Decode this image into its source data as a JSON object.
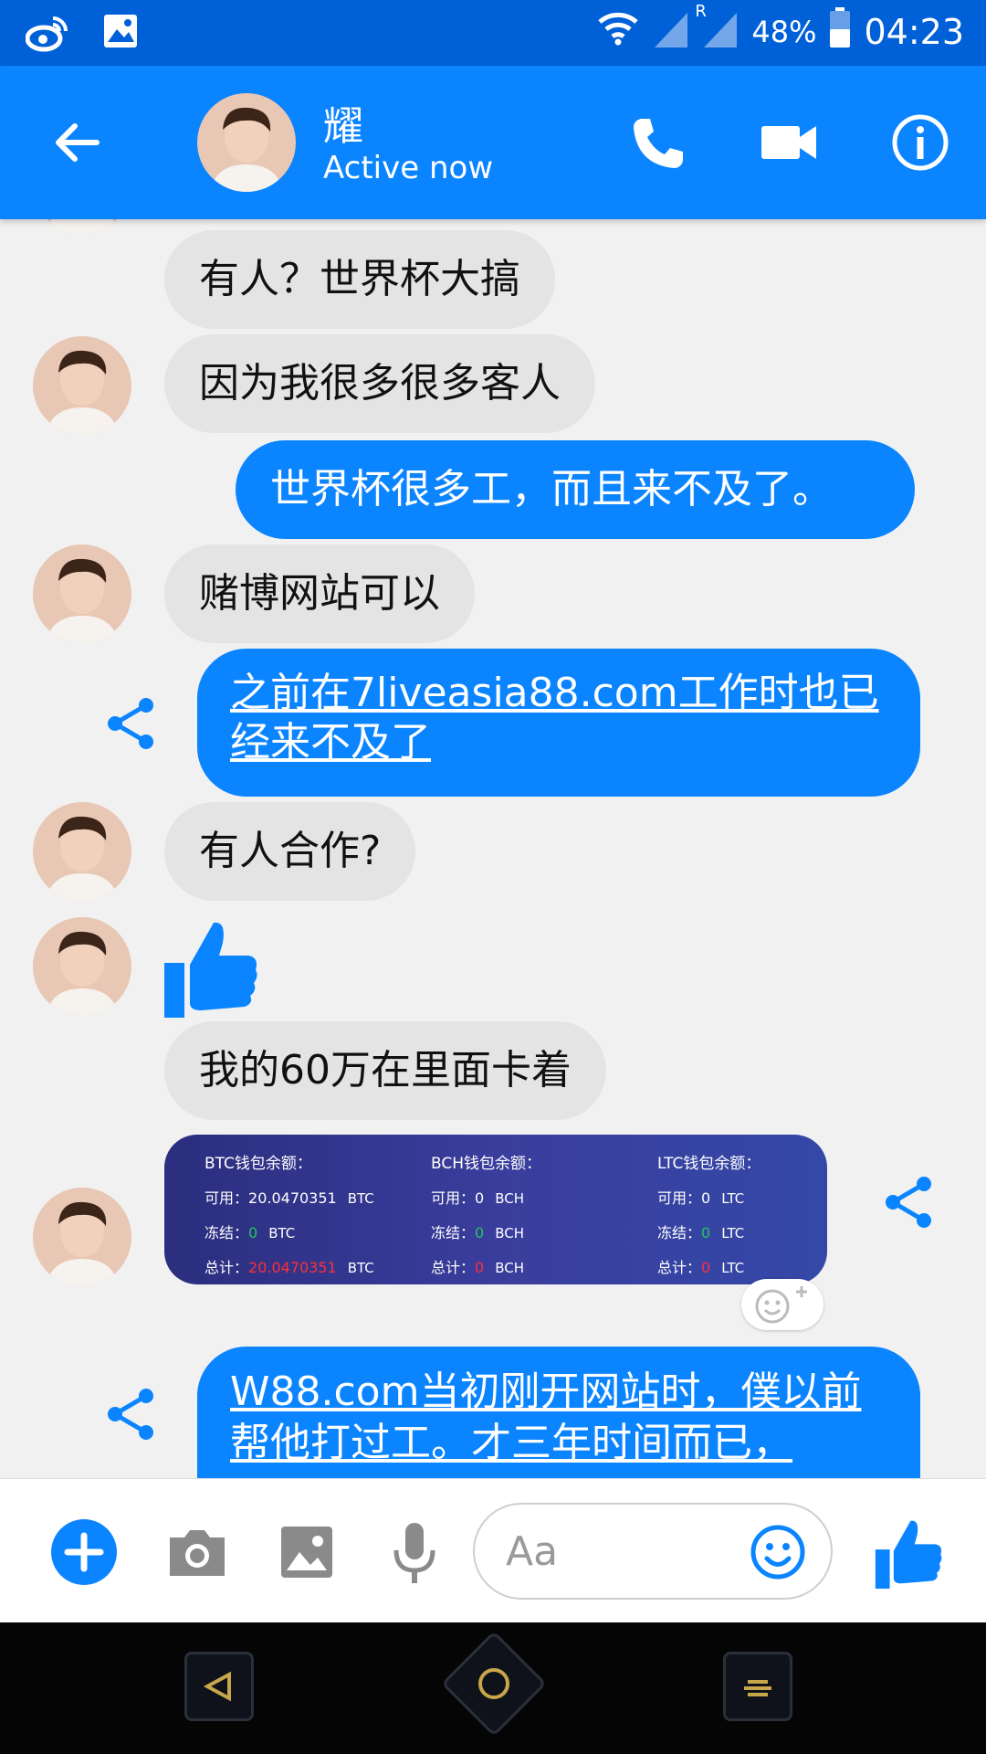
{
  "status_bar": {
    "battery": "48%",
    "time": "04:23",
    "roaming": "R"
  },
  "header": {
    "contact_name": "耀",
    "contact_status": "Active now"
  },
  "messages": [
    {
      "dir": "in",
      "text": "有人？世界杯大搞"
    },
    {
      "dir": "in",
      "text": "因为我很多很多客人"
    },
    {
      "dir": "out",
      "text": "世界杯很多工，而且来不及了。"
    },
    {
      "dir": "in",
      "text": "赌博网站可以"
    },
    {
      "dir": "out",
      "text": "之前在7liveasia88.com工作时也已经来不及了"
    },
    {
      "dir": "in",
      "text": "有人合作?"
    },
    {
      "dir": "in",
      "type": "like"
    },
    {
      "dir": "in",
      "text": "我的60万在里面卡着"
    },
    {
      "dir": "in",
      "type": "image"
    },
    {
      "dir": "out",
      "text": "W88.com当初刚开网站时，僕以前帮他打过工。才三年时间而已，"
    }
  ],
  "wallet_image": {
    "btc": {
      "header": "BTC钱包余额：",
      "available_label": "可用：",
      "available": "20.0470351",
      "frozen_label": "冻结：",
      "frozen": "0",
      "total_label": "总计：",
      "total": "20.0470351",
      "unit": "BTC"
    },
    "bch": {
      "header": "BCH钱包余额：",
      "available_label": "可用：",
      "available": "0",
      "frozen_label": "冻结：",
      "frozen": "0",
      "total_label": "总计：",
      "total": "0",
      "unit": "BCH"
    },
    "ltc": {
      "header": "LTC钱包余额：",
      "available_label": "可用：",
      "available": "0",
      "frozen_label": "冻结：",
      "frozen": "0",
      "total_label": "总计：",
      "total": "0",
      "unit": "LTC"
    }
  },
  "composer": {
    "placeholder": "Aa"
  },
  "colors": {
    "messenger_blue": "#0a84ff",
    "status_bar": "#0060d8",
    "incoming_bubble": "#e4e4e4"
  },
  "icons": [
    "weibo-icon",
    "gallery-icon",
    "wifi-icon",
    "signal-icon",
    "battery-icon",
    "back-arrow-icon",
    "phone-icon",
    "video-icon",
    "info-icon",
    "share-icon",
    "thumbs-up-icon",
    "add-reaction-icon",
    "plus-icon",
    "camera-icon",
    "image-icon",
    "microphone-icon",
    "emoji-icon",
    "nav-back-icon",
    "nav-home-icon",
    "nav-recents-icon"
  ]
}
